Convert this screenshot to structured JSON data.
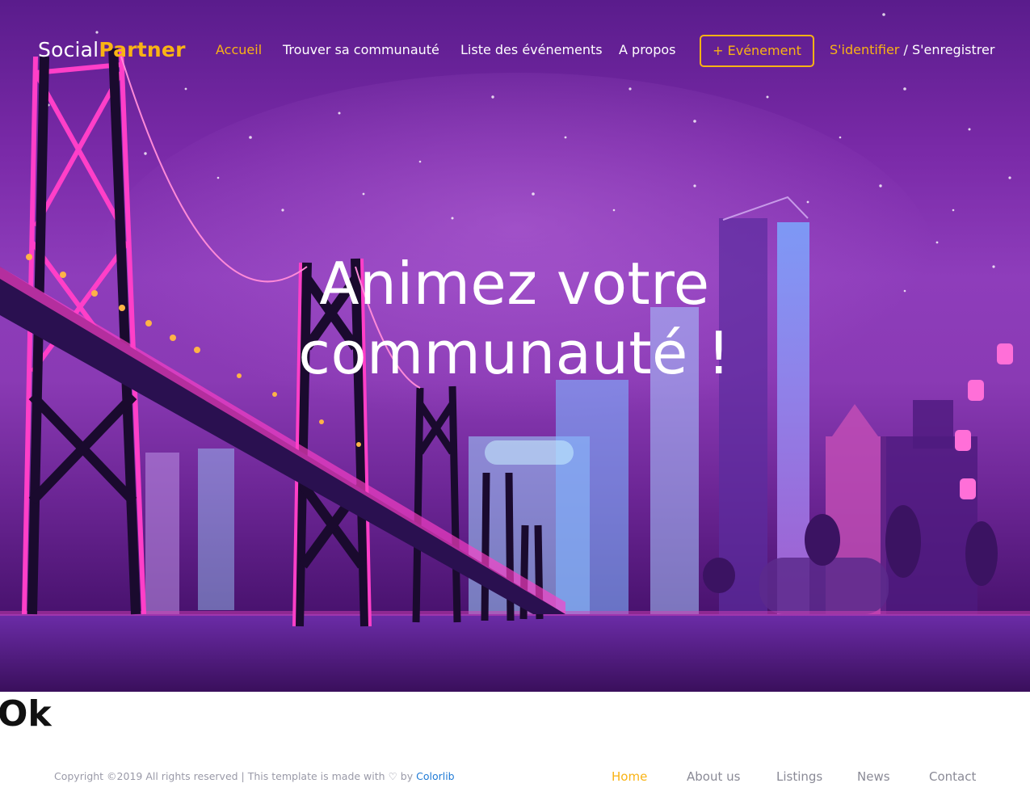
{
  "brand": {
    "part1": "Social",
    "part2": "Partner"
  },
  "nav": {
    "items": [
      {
        "label": "Accueil",
        "active": true
      },
      {
        "label": "Trouver sa communauté",
        "active": false
      },
      {
        "label": "Liste des événements",
        "active": false
      },
      {
        "label": "A propos",
        "active": false
      }
    ],
    "event_button": "+ Evénement",
    "login": "S'identifier",
    "separator": "/",
    "register": "S'enregistrer"
  },
  "hero": {
    "title_line1": "Animez votre",
    "title_line2": "communauté !"
  },
  "content": {
    "text": "Ok"
  },
  "footer": {
    "copyright": "Copyright ©2019 All rights reserved | This template is made with",
    "by": "by",
    "credit_link": "Colorlib",
    "links": [
      {
        "label": "Home",
        "active": true
      },
      {
        "label": "About us",
        "active": false
      },
      {
        "label": "Listings",
        "active": false
      },
      {
        "label": "News",
        "active": false
      },
      {
        "label": "Contact",
        "active": false
      }
    ]
  },
  "colors": {
    "accent": "#f9b314",
    "hero_purple": "#7a2aa8",
    "link_blue": "#1f7ad6"
  }
}
